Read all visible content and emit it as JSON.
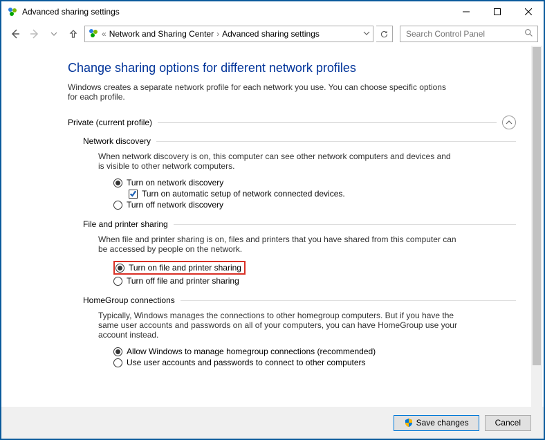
{
  "window": {
    "title": "Advanced sharing settings"
  },
  "breadcrumb": {
    "prefix": "«",
    "item1": "Network and Sharing Center",
    "item2": "Advanced sharing settings"
  },
  "search": {
    "placeholder": "Search Control Panel"
  },
  "page": {
    "heading": "Change sharing options for different network profiles",
    "intro": "Windows creates a separate network profile for each network you use. You can choose specific options for each profile."
  },
  "profile": {
    "title": "Private (current profile)"
  },
  "netdisc": {
    "title": "Network discovery",
    "desc": "When network discovery is on, this computer can see other network computers and devices and is visible to other network computers.",
    "opt_on": "Turn on network discovery",
    "opt_auto": "Turn on automatic setup of network connected devices.",
    "opt_off": "Turn off network discovery"
  },
  "fps": {
    "title": "File and printer sharing",
    "desc": "When file and printer sharing is on, files and printers that you have shared from this computer can be accessed by people on the network.",
    "opt_on": "Turn on file and printer sharing",
    "opt_off": "Turn off file and printer sharing"
  },
  "hg": {
    "title": "HomeGroup connections",
    "desc": "Typically, Windows manages the connections to other homegroup computers. But if you have the same user accounts and passwords on all of your computers, you can have HomeGroup use your account instead.",
    "opt_allow": "Allow Windows to manage homegroup connections (recommended)",
    "opt_user": "Use user accounts and passwords to connect to other computers"
  },
  "footer": {
    "save": "Save changes",
    "cancel": "Cancel"
  }
}
